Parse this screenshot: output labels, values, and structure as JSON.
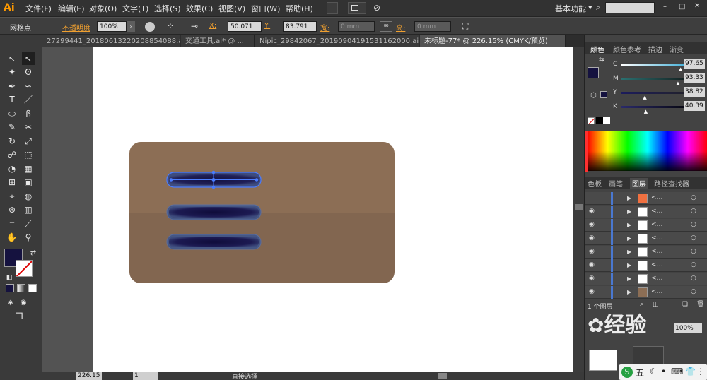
{
  "app": {
    "logo": "Ai",
    "workspace": "基本功能",
    "workspace_caret": "▾"
  },
  "menu": [
    "文件(F)",
    "编辑(E)",
    "对象(O)",
    "文字(T)",
    "选择(S)",
    "效果(C)",
    "视图(V)",
    "窗口(W)",
    "帮助(H)"
  ],
  "control": {
    "tool_label": "网格点",
    "opacity_label": "不透明度",
    "opacity_value": "100%",
    "x_label": "X:",
    "x_value": "50.071 mm",
    "y_label": "Y:",
    "y_value": "83.791 mm",
    "w_label": "宽:",
    "w_value": "0 mm",
    "h_label": "高:",
    "h_value": "0 mm"
  },
  "tabs": [
    {
      "label": "27299441_20180613220208854088.ai* ...",
      "active": false
    },
    {
      "label": "交通工具.ai* @ ...",
      "active": false
    },
    {
      "label": "Nipic_29842067_20190904191531162000.ai* ...",
      "active": false
    },
    {
      "label": "未标题-77* @ 226.15% (CMYK/预览)",
      "active": true
    }
  ],
  "color_panel": {
    "tabs": [
      "颜色",
      "颜色参考",
      "描边",
      "渐变"
    ],
    "fill_color": "#15123f",
    "sliders": [
      {
        "label": "C",
        "value": "97.65",
        "pos": 0.9765
      },
      {
        "label": "M",
        "value": "93.33",
        "pos": 0.9333
      },
      {
        "label": "Y",
        "value": "38.82",
        "pos": 0.3882
      },
      {
        "label": "K",
        "value": "40.39",
        "pos": 0.4039
      }
    ]
  },
  "layers_panel": {
    "tabs": [
      "色板",
      "画笔",
      "图层",
      "路径查找器"
    ],
    "footer_label": "1 个图层",
    "row_count": 8
  },
  "transparency": {
    "value": "100%"
  },
  "status": {
    "zoom": "226.15",
    "page": "1",
    "tool": "直接选择"
  },
  "artwork": {
    "card_color": "#8c6e55",
    "card_lower_color": "#826650",
    "slot_color": "#1a1846",
    "slot_outline": "#5b6f9a",
    "selection_color": "#4a7cff"
  },
  "watermark": {
    "text": "经验"
  },
  "ime": {
    "label": "五"
  }
}
